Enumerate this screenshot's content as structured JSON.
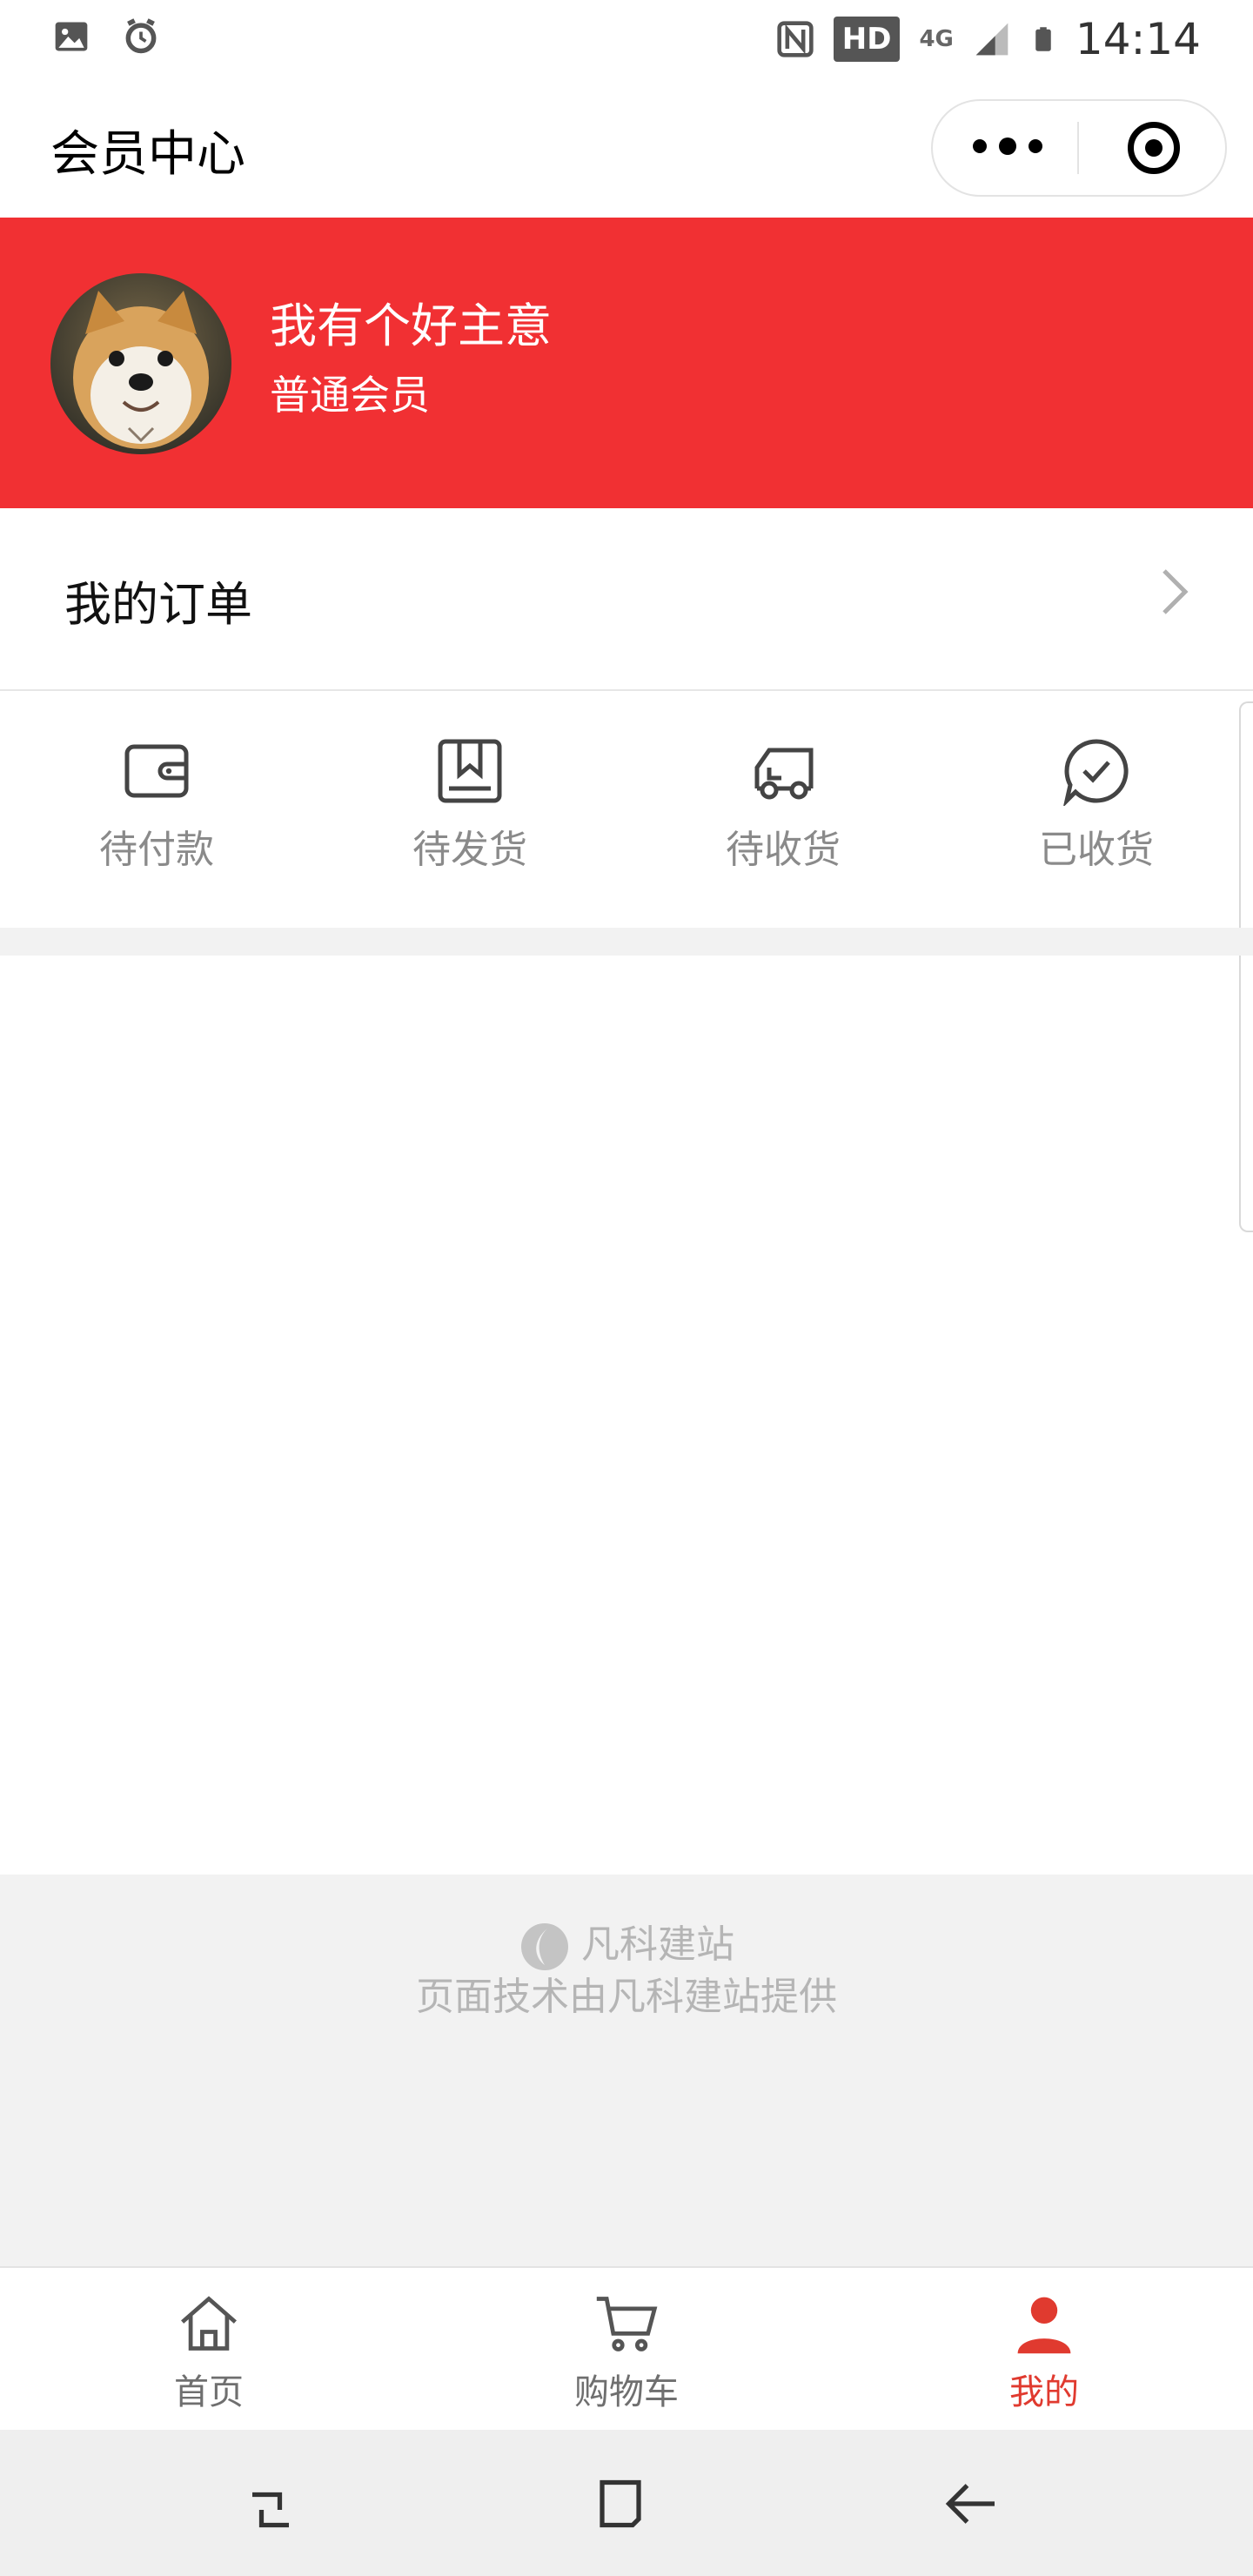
{
  "status_bar": {
    "time": "14:14",
    "hd_badge": "HD",
    "network": "4G",
    "icons": [
      "image-icon",
      "alarm-icon",
      "nfc-icon",
      "signal-icon",
      "battery-icon"
    ]
  },
  "nav": {
    "title": "会员中心",
    "more_icon": "more-dots-icon",
    "close_icon": "target-icon"
  },
  "profile": {
    "username": "我有个好主意",
    "level": "普通会员",
    "background_color": "#f13033"
  },
  "orders": {
    "title": "我的订单",
    "arrow_icon": "chevron-right-icon",
    "statuses": [
      {
        "label": "待付款",
        "icon": "wallet-icon"
      },
      {
        "label": "待发货",
        "icon": "bookmark-box-icon"
      },
      {
        "label": "待收货",
        "icon": "truck-icon"
      },
      {
        "label": "已收货",
        "icon": "chat-check-icon"
      }
    ]
  },
  "credit": {
    "brand": "凡科建站",
    "text": "页面技术由凡科建站提供"
  },
  "tabbar": {
    "active_color": "#e03a2f",
    "items": [
      {
        "label": "首页",
        "icon": "home-icon"
      },
      {
        "label": "购物车",
        "icon": "cart-icon"
      },
      {
        "label": "我的",
        "icon": "user-icon",
        "active": true
      }
    ]
  },
  "system_nav": [
    "recent-apps-icon",
    "home-square-icon",
    "back-arrow-icon"
  ]
}
